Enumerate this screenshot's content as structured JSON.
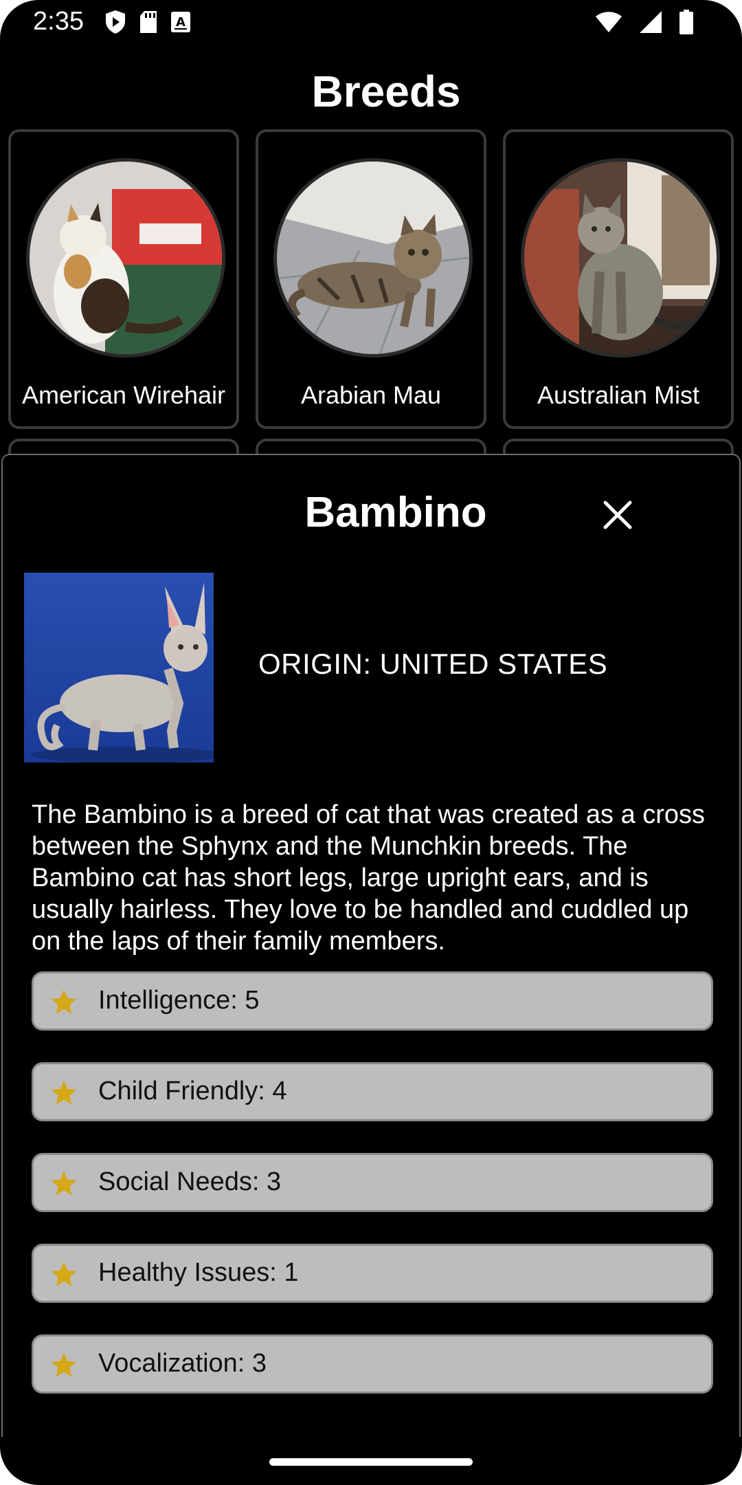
{
  "status_bar": {
    "time": "2:35",
    "left_icons": [
      "shield-play-icon",
      "sd-card-icon",
      "font-icon"
    ],
    "right_icons": [
      "wifi-icon",
      "signal-icon",
      "battery-icon"
    ]
  },
  "header": {
    "title": "Breeds"
  },
  "breeds": [
    {
      "name": "American Wirehair",
      "photo": "cat-photo-icon"
    },
    {
      "name": "Arabian Mau",
      "photo": "cat-photo-icon"
    },
    {
      "name": "Australian Mist",
      "photo": "cat-photo-icon"
    }
  ],
  "detail": {
    "name": "Bambino",
    "origin": "ORIGIN: UNITED STATES",
    "description": "The Bambino is a breed of cat that was created as a cross between the Sphynx and the Munchkin breeds. The Bambino cat has short legs, large upright ears, and is usually hairless. They love to be handled and cuddled up on the laps of their family members.",
    "stats": [
      {
        "label": "Intelligence: 5"
      },
      {
        "label": "Child Friendly: 4"
      },
      {
        "label": "Social Needs: 3"
      },
      {
        "label": "Healthy Issues: 1"
      },
      {
        "label": "Vocalization: 3"
      }
    ]
  },
  "colors": {
    "background": "#000000",
    "stat_bg": "#bdbdbd",
    "star": "#d4a817",
    "card_border": "#3b3b3b"
  }
}
